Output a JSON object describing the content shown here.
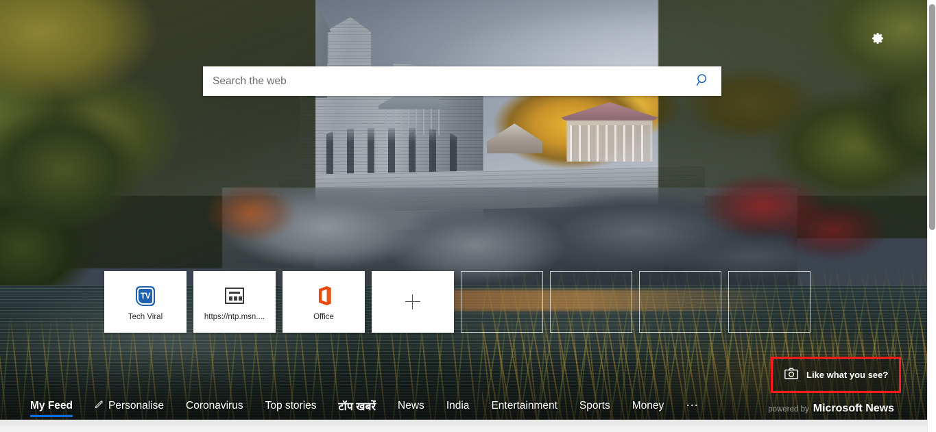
{
  "page": {
    "background_image_description": "Belvedere Castle in Central Park with autumn foliage and lake",
    "accent_color": "#0e6fd4",
    "highlight_color": "#f71b1b"
  },
  "settings": {
    "icon": "gear-icon",
    "label": "Page settings"
  },
  "search": {
    "placeholder": "Search the web",
    "value": "",
    "button_icon": "search-icon",
    "icon_color": "#0a5bb5"
  },
  "tiles": [
    {
      "label": "Tech Viral",
      "icon": "tv-badge-icon",
      "type": "site"
    },
    {
      "label": "https://ntp.msn....",
      "icon": "page-icon",
      "type": "site"
    },
    {
      "label": "Office",
      "icon": "office-icon",
      "type": "site"
    },
    {
      "label": "",
      "icon": "plus-icon",
      "type": "add"
    },
    {
      "label": "",
      "icon": "",
      "type": "ghost"
    },
    {
      "label": "",
      "icon": "",
      "type": "ghost"
    },
    {
      "label": "",
      "icon": "",
      "type": "ghost"
    },
    {
      "label": "",
      "icon": "",
      "type": "ghost"
    }
  ],
  "like_button": {
    "label": "Like what you see?",
    "icon": "camera-icon",
    "highlighted": true
  },
  "nav": {
    "items": [
      {
        "label": "My Feed",
        "active": true,
        "icon": ""
      },
      {
        "label": "Personalise",
        "active": false,
        "icon": "pencil-icon"
      },
      {
        "label": "Coronavirus",
        "active": false,
        "icon": ""
      },
      {
        "label": "Top stories",
        "active": false,
        "icon": ""
      },
      {
        "label": "टॉप खबरें",
        "active": false,
        "icon": "",
        "script": "hindi"
      },
      {
        "label": "News",
        "active": false,
        "icon": ""
      },
      {
        "label": "India",
        "active": false,
        "icon": ""
      },
      {
        "label": "Entertainment",
        "active": false,
        "icon": ""
      },
      {
        "label": "Sports",
        "active": false,
        "icon": ""
      },
      {
        "label": "Money",
        "active": false,
        "icon": ""
      },
      {
        "label": "⋯",
        "active": false,
        "icon": "",
        "overflow": true
      }
    ],
    "brand_prefix": "powered by",
    "brand_name": "Microsoft News"
  },
  "scrollbar": {
    "orientation": "vertical",
    "thumb_position": "top"
  }
}
